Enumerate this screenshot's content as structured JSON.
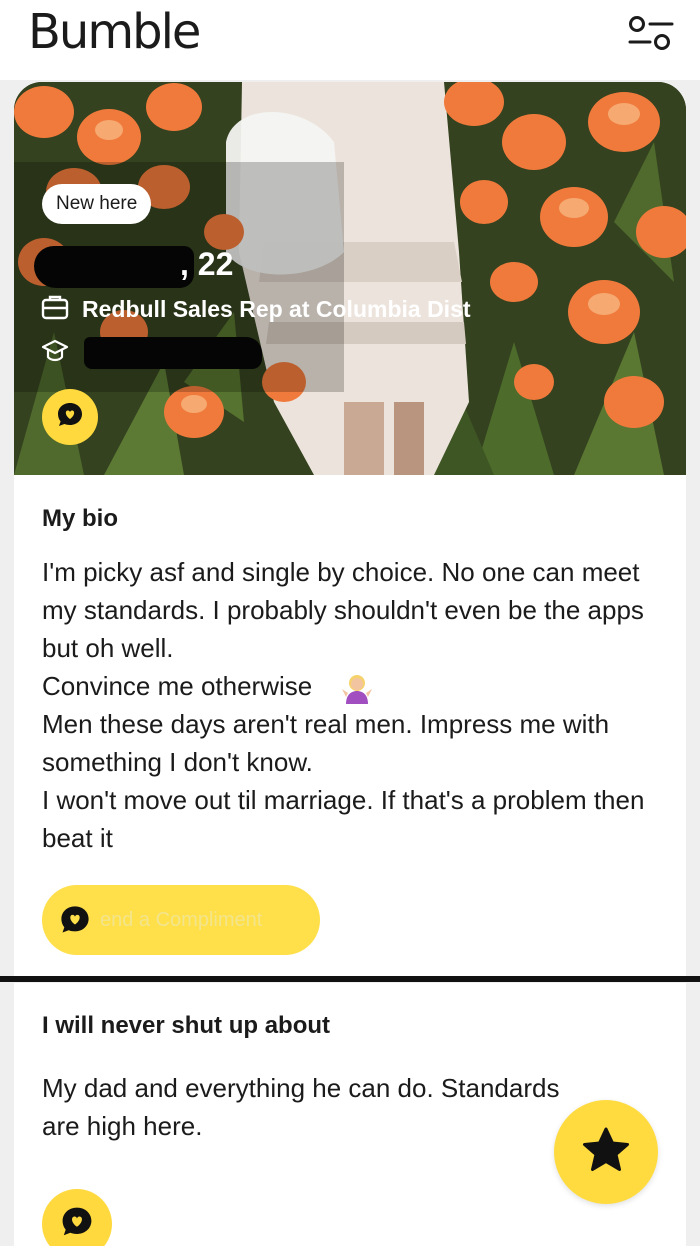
{
  "app": {
    "title": "Bumble"
  },
  "header": {
    "filter_icon": "filter-sliders-icon"
  },
  "profile": {
    "badge": "New here",
    "age": ", 22",
    "job": "Redbull Sales Rep at Columbia Dist",
    "job_icon": "briefcase-icon",
    "education_icon": "graduation-cap-icon",
    "photo_action_icon": "chat-heart-icon"
  },
  "bio": {
    "heading": "My bio",
    "text": "I'm picky asf and single by choice. No one can meet my standards. I probably shouldn't even be the apps but oh well.\nConvince me otherwise\nMen these days aren't real men. Impress me with something I don't know.\nI won't move out til marriage. If that's a problem then beat it",
    "emoji": "woman-shrugging-emoji"
  },
  "compliment": {
    "label": "end a Compliment",
    "icon": "chat-heart-icon"
  },
  "prompt": {
    "heading": "I will never shut up about",
    "text": "My dad and everything he can do. Standards\nare high here.",
    "icon": "chat-heart-icon"
  },
  "fab": {
    "icon": "star-icon"
  },
  "colors": {
    "accent": "#ffd93e",
    "text": "#1b1b1b",
    "background": "#efefef"
  }
}
